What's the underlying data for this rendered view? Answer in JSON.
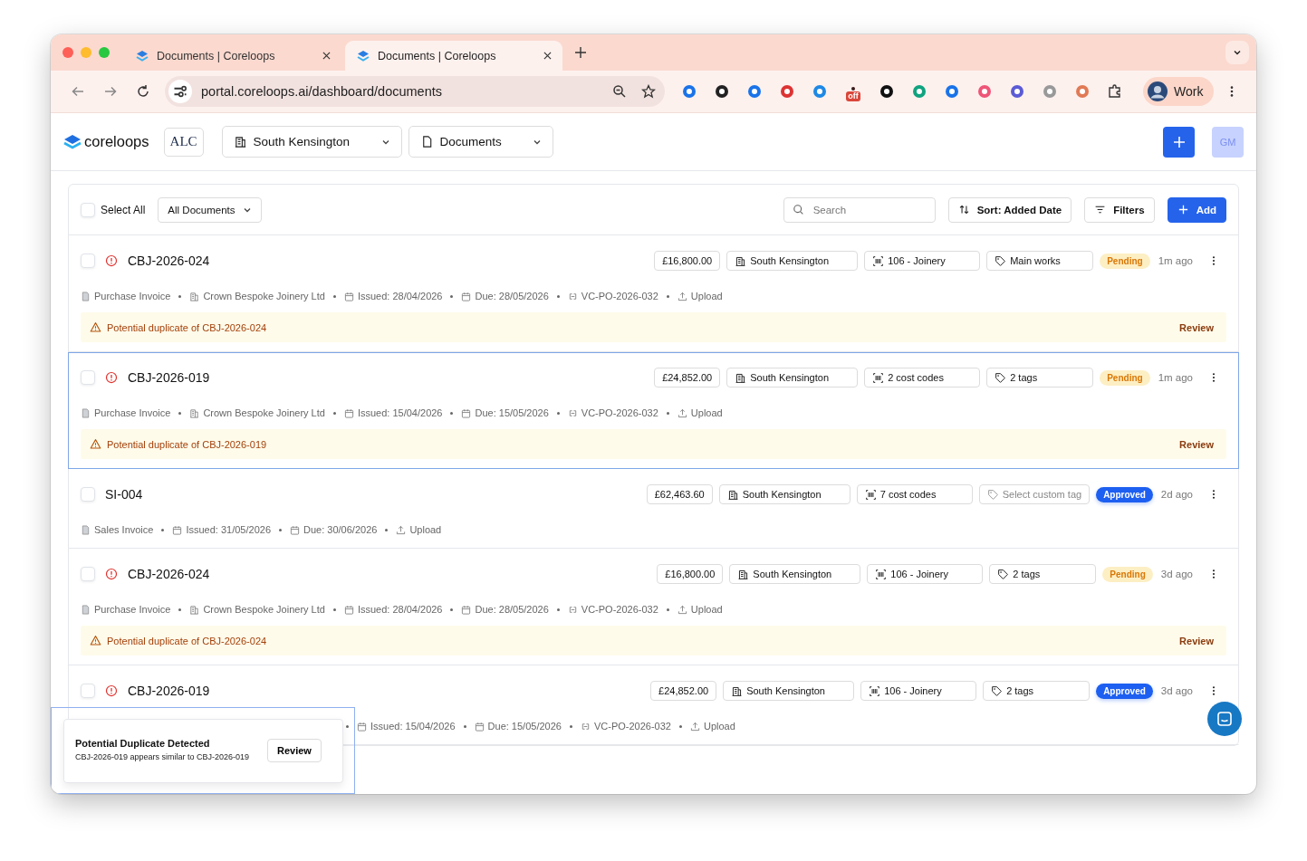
{
  "browser": {
    "tabs": [
      {
        "title": "Documents | Coreloops",
        "selected": false
      },
      {
        "title": "Documents | Coreloops",
        "selected": true
      }
    ],
    "url": "portal.coreloops.ai/dashboard/documents",
    "extension_badge": "off",
    "profile": "Work"
  },
  "header": {
    "brand": "coreloops",
    "client_logo": "ALC",
    "site": "South Kensington",
    "section": "Documents",
    "avatar": "GM"
  },
  "toolbar": {
    "select_all": {
      "label": "Select All",
      "checked": false
    },
    "filter": "All Documents",
    "search": {
      "placeholder": "Search"
    },
    "sort": "Sort: Added Date",
    "filters": "Filters",
    "add": "Add"
  },
  "rows": [
    {
      "id": "CBJ-2026-024",
      "checked": false,
      "selected": false,
      "alert": true,
      "amount": "£16,800.00",
      "site": "South Kensington",
      "cost_code": "106 - Joinery",
      "tag": {
        "text": "Main works",
        "placeholder": false
      },
      "status": {
        "text": "Pending",
        "kind": "pending"
      },
      "time": "1m ago",
      "covered": false,
      "meta": [
        {
          "kind": "doc",
          "text": "Purchase Invoice"
        },
        {
          "kind": "company",
          "text": "Crown Bespoke Joinery Ltd"
        },
        {
          "kind": "date",
          "text": "Issued: 28/04/2026"
        },
        {
          "kind": "date",
          "text": "Due: 28/05/2026"
        },
        {
          "kind": "po",
          "text": "VC-PO-2026-032"
        },
        {
          "kind": "upload",
          "text": "Upload"
        }
      ],
      "warning": {
        "text": "Potential duplicate of CBJ-2026-024",
        "action": "Review"
      }
    },
    {
      "id": "CBJ-2026-019",
      "checked": false,
      "selected": true,
      "alert": true,
      "amount": "£24,852.00",
      "site": "South Kensington",
      "cost_code": "2 cost codes",
      "tag": {
        "text": "2 tags",
        "placeholder": false
      },
      "status": {
        "text": "Pending",
        "kind": "pending"
      },
      "time": "1m ago",
      "covered": false,
      "meta": [
        {
          "kind": "doc",
          "text": "Purchase Invoice"
        },
        {
          "kind": "company",
          "text": "Crown Bespoke Joinery Ltd"
        },
        {
          "kind": "date",
          "text": "Issued: 15/04/2026"
        },
        {
          "kind": "date",
          "text": "Due: 15/05/2026"
        },
        {
          "kind": "po",
          "text": "VC-PO-2026-032"
        },
        {
          "kind": "upload",
          "text": "Upload"
        }
      ],
      "warning": {
        "text": "Potential duplicate of CBJ-2026-019",
        "action": "Review"
      }
    },
    {
      "id": "SI-004",
      "checked": false,
      "selected": false,
      "alert": false,
      "amount": "£62,463.60",
      "site": "South Kensington",
      "cost_code": "7 cost codes",
      "tag": {
        "text": "Select custom tag",
        "placeholder": true
      },
      "status": {
        "text": "Approved",
        "kind": "approved"
      },
      "time": "2d ago",
      "covered": false,
      "meta": [
        {
          "kind": "doc",
          "text": "Sales Invoice"
        },
        {
          "kind": "date",
          "text": "Issued: 31/05/2026"
        },
        {
          "kind": "date",
          "text": "Due: 30/06/2026"
        },
        {
          "kind": "upload",
          "text": "Upload"
        }
      ]
    },
    {
      "id": "CBJ-2026-024",
      "checked": false,
      "selected": false,
      "alert": true,
      "amount": "£16,800.00",
      "site": "South Kensington",
      "cost_code": "106 - Joinery",
      "tag": {
        "text": "2 tags",
        "placeholder": false
      },
      "status": {
        "text": "Pending",
        "kind": "pending"
      },
      "time": "3d ago",
      "covered": false,
      "meta": [
        {
          "kind": "doc",
          "text": "Purchase Invoice"
        },
        {
          "kind": "company",
          "text": "Crown Bespoke Joinery Ltd"
        },
        {
          "kind": "date",
          "text": "Issued: 28/04/2026"
        },
        {
          "kind": "date",
          "text": "Due: 28/05/2026"
        },
        {
          "kind": "po",
          "text": "VC-PO-2026-032"
        },
        {
          "kind": "upload",
          "text": "Upload"
        }
      ],
      "warning": {
        "text": "Potential duplicate of CBJ-2026-024",
        "action": "Review"
      }
    },
    {
      "id": "CBJ-2026-019",
      "checked": false,
      "selected": false,
      "alert": true,
      "amount": "£24,852.00",
      "site": "South Kensington",
      "cost_code": "106 - Joinery",
      "tag": {
        "text": "2 tags",
        "placeholder": false
      },
      "status": {
        "text": "Approved",
        "kind": "approved"
      },
      "time": "3d ago",
      "covered": true,
      "meta": [
        {
          "kind": "date",
          "text": "Issued: 15/04/2026"
        },
        {
          "kind": "date",
          "text": "Due: 15/05/2026"
        },
        {
          "kind": "po",
          "text": "VC-PO-2026-032"
        },
        {
          "kind": "upload",
          "text": "Upload"
        }
      ]
    }
  ],
  "toast": {
    "title": "Potential Duplicate Detected",
    "message": "CBJ-2026-019 appears similar to CBJ-2026-019",
    "action": "Review"
  }
}
